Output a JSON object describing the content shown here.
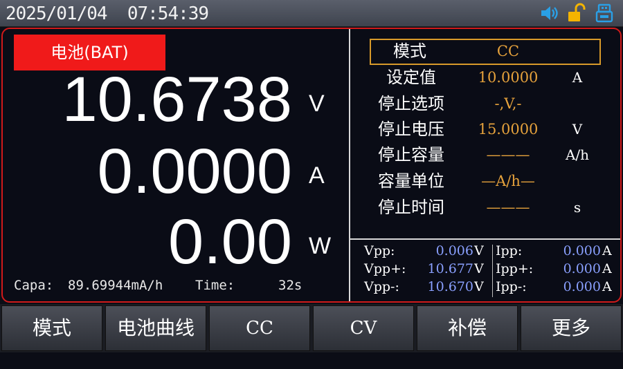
{
  "status_bar": {
    "datetime": "2025/01/04  07:54:39",
    "icons": [
      "speaker-icon",
      "unlock-icon",
      "usb-icon"
    ],
    "icon_colors": {
      "speaker": "#2aa0e6",
      "lock": "#f4b400",
      "usb": "#2aa0e6"
    }
  },
  "measure": {
    "mode_label": "电池(BAT)",
    "voltage": "10.6738",
    "voltage_unit": "V",
    "current": "0.0000",
    "current_unit": "A",
    "power": "0.00",
    "power_unit": "W",
    "capa_label": "Capa:",
    "capa_value": "89.69944mA/h",
    "time_label": "Time:",
    "time_value": "32s"
  },
  "settings": {
    "mode": {
      "label": "模式",
      "value": "CC"
    },
    "rows": [
      {
        "label": "设定值",
        "value": "10.0000",
        "unit": "A"
      },
      {
        "label": "停止选项",
        "value": "-,V,-",
        "unit": ""
      },
      {
        "label": "停止电压",
        "value": "15.0000",
        "unit": "V"
      },
      {
        "label": "停止容量",
        "value": "———",
        "unit": "A/h"
      },
      {
        "label": "容量单位",
        "value": "—A/h—",
        "unit": ""
      },
      {
        "label": "停止时间",
        "value": "———",
        "unit": "s"
      }
    ]
  },
  "ripple": {
    "vpp": {
      "label": "Vpp:",
      "value": "0.006",
      "unit": "V"
    },
    "vpp_plus": {
      "label": "Vpp+:",
      "value": "10.677",
      "unit": "V"
    },
    "vpp_minus": {
      "label": "Vpp-:",
      "value": "10.670",
      "unit": "V"
    },
    "ipp": {
      "label": "Ipp:",
      "value": "0.000",
      "unit": "A"
    },
    "ipp_plus": {
      "label": "Ipp+:",
      "value": "0.000",
      "unit": "A"
    },
    "ipp_minus": {
      "label": "Ipp-:",
      "value": "0.000",
      "unit": "A"
    }
  },
  "softkeys": [
    "模式",
    "电池曲线",
    "CC",
    "CV",
    "补偿",
    "更多"
  ],
  "colors": {
    "accent_red": "#f01a1a",
    "value_orange": "#e6a23c",
    "ripple_blue": "#8aa0ff"
  }
}
